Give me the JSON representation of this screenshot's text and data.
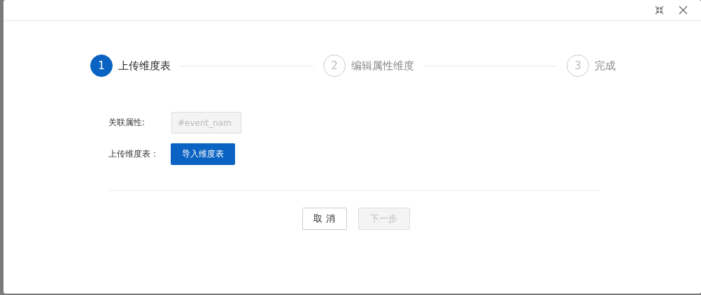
{
  "steps": [
    {
      "number": "1",
      "label": "上传维度表",
      "active": true
    },
    {
      "number": "2",
      "label": "编辑属性维度",
      "active": false
    },
    {
      "number": "3",
      "label": "完成",
      "active": false
    }
  ],
  "form": {
    "relation_label": "关联属性:",
    "relation_value": "#event_nam",
    "relation_disabled": true,
    "upload_label": "上传维度表：",
    "upload_button": "导入维度表"
  },
  "footer": {
    "cancel": "取 消",
    "next": "下一步",
    "next_disabled": true
  }
}
